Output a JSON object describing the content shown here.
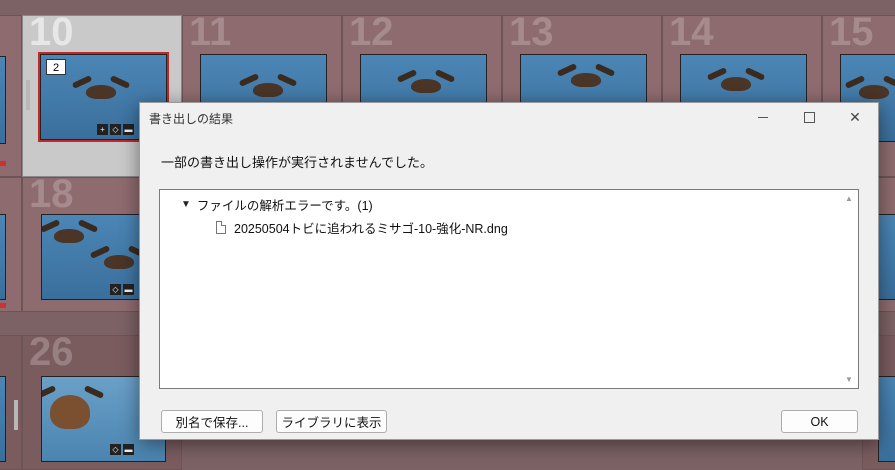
{
  "grid": {
    "cells": [
      {
        "number": "10",
        "badge": "2",
        "selected": true
      },
      {
        "number": "11"
      },
      {
        "number": "12"
      },
      {
        "number": "13"
      },
      {
        "number": "14"
      },
      {
        "number": "15"
      },
      {
        "number": "18"
      },
      {
        "number": "26"
      }
    ]
  },
  "dialog": {
    "title": "書き出しの結果",
    "message": "一部の書き出し操作が実行されませんでした。",
    "error_group": "ファイルの解析エラーです。(1)",
    "error_file": "20250504トビに追われるミサゴ-10-強化-NR.dng",
    "buttons": {
      "save_as": "別名で保存...",
      "show_in_library": "ライブラリに表示",
      "ok": "OK"
    }
  },
  "colors": {
    "grid_bg": "#8e6b6f",
    "selected_cell": "#c9c9c9",
    "selection_frame": "#c0282a",
    "dialog_bg": "#f0f0f0"
  }
}
